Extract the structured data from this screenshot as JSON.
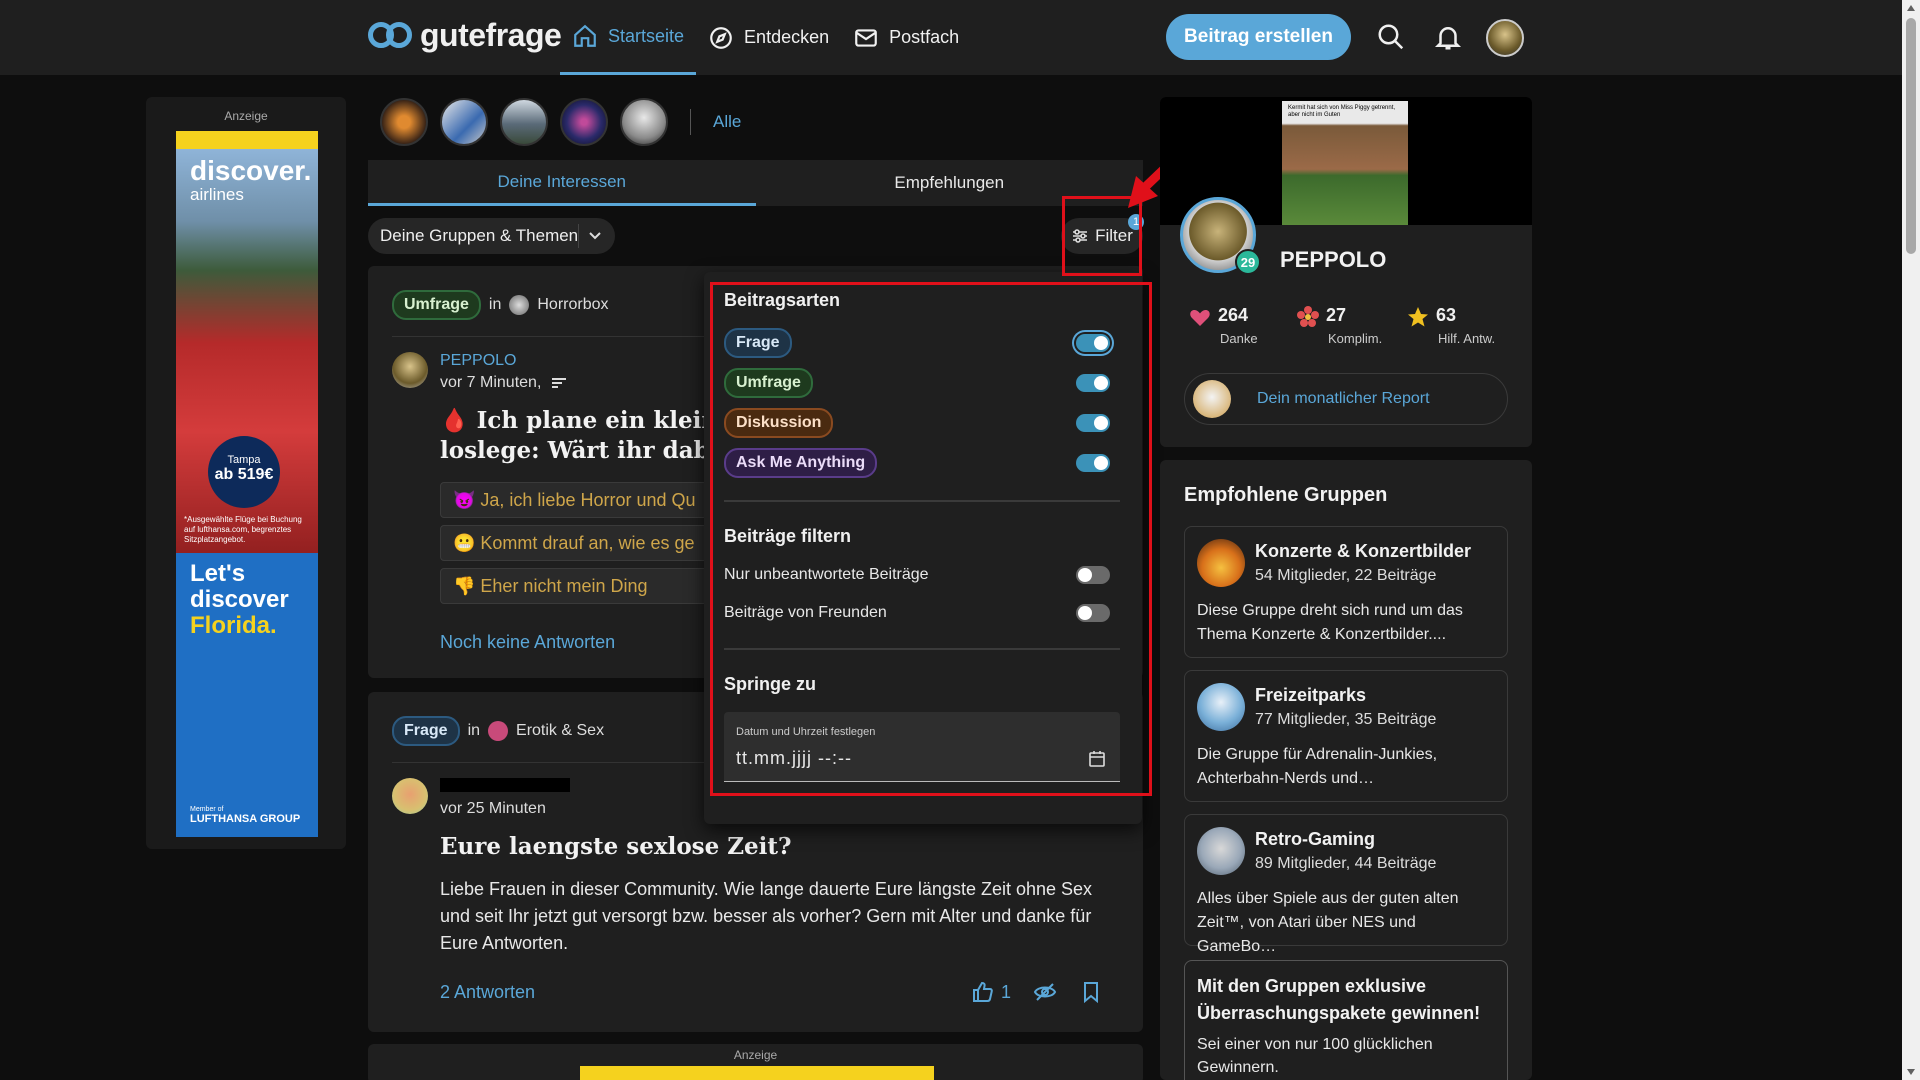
{
  "header": {
    "logo_text": "gutefrage",
    "nav": [
      {
        "label": "Startseite",
        "icon": "home-icon",
        "active": true
      },
      {
        "label": "Entdecken",
        "icon": "compass-icon",
        "active": false
      },
      {
        "label": "Postfach",
        "icon": "mail-icon",
        "active": false
      }
    ],
    "create_label": "Beitrag erstellen"
  },
  "ad_left": {
    "label": "Anzeige",
    "brand": "discover.",
    "brand_sub": "airlines",
    "price_top": "Tampa",
    "price": "ab 519€",
    "fine_print": "*Ausgewählte Flüge bei Buchung auf lufthansa.com, begrenztes Sitzplatzangebot.",
    "slogan1": "Let's",
    "slogan2": "discover",
    "slogan3": "Florida.",
    "footer_small": "Member of",
    "footer": "LUFTHANSA GROUP"
  },
  "chips": {
    "all_label": "Alle",
    "items": [
      {
        "name": "music-chip",
        "color": "#3a2416"
      },
      {
        "name": "tech-chip",
        "color": "#c9c9c9"
      },
      {
        "name": "landscape-chip",
        "color": "#8a9aa8"
      },
      {
        "name": "space-chip",
        "color": "#5a2a7a"
      },
      {
        "name": "alien-chip",
        "color": "#bdbdbd"
      }
    ]
  },
  "tabs": [
    {
      "label": "Deine Interessen",
      "active": true
    },
    {
      "label": "Empfehlungen",
      "active": false
    }
  ],
  "group_select": "Deine Gruppen & Themen",
  "filter": {
    "label": "Filter",
    "badge": "1"
  },
  "posts": [
    {
      "type": "Umfrage",
      "in": "in",
      "group": "Horrorbox",
      "author": "PEPPOLO",
      "time": "vor 7 Minuten,",
      "title_line1": "🩸 Ich plane ein kleines",
      "title_line2": "loslege: Wärt ihr dabei?",
      "options": [
        "😈 Ja, ich liebe Horror und Qu",
        "😬 Kommt drauf an, wie es ge",
        "👎 Eher nicht mein Ding"
      ],
      "answers": "Noch keine Antworten"
    },
    {
      "type": "Frage",
      "in": "in",
      "group": "Erotik & Sex",
      "time": "vor 25 Minuten",
      "title": "Eure laengste sexlose Zeit?",
      "body": "Liebe Frauen in dieser Community. Wie lange dauerte Eure längste Zeit ohne Sex und seit Ihr jetzt gut versorgt bzw. besser als vorher? Gern mit Alter und danke für Eure Antworten.",
      "answers": "2 Antworten",
      "likes": "1"
    }
  ],
  "ad_bottom_label": "Anzeige",
  "dropdown": {
    "section1": "Beitragsarten",
    "types": [
      {
        "label": "Frage",
        "on": true
      },
      {
        "label": "Umfrage",
        "on": true
      },
      {
        "label": "Diskussion",
        "on": true
      },
      {
        "label": "Ask Me Anything",
        "on": true
      }
    ],
    "section2": "Beiträge filtern",
    "filters": [
      {
        "label": "Nur unbeantwortete Beiträge",
        "on": false
      },
      {
        "label": "Beiträge von Freunden",
        "on": false
      }
    ],
    "section3": "Springe zu",
    "date_label": "Datum und Uhrzeit festlegen",
    "date_value": "tt.mm.jjjj --:--"
  },
  "profile": {
    "name": "PEPPOLO",
    "level": "29",
    "meme_text": "Kermit hat sich von Miss Piggy getrennt, aber nicht im Guten",
    "stats": [
      {
        "num": "264",
        "label": "Danke",
        "icon": "heart-icon",
        "color": "#e0507a"
      },
      {
        "num": "27",
        "label": "Komplim.",
        "icon": "flower-icon",
        "color": "#e05050"
      },
      {
        "num": "63",
        "label": "Hilf. Antw.",
        "icon": "star-icon",
        "color": "#f0c020"
      }
    ],
    "report": "Dein monatlicher Report"
  },
  "groups": {
    "title": "Empfohlene Gruppen",
    "items": [
      {
        "name": "Konzerte & Konzertbilder",
        "meta": "54 Mitglieder, 22 Beiträge",
        "desc": "Diese Gruppe dreht sich rund um das Thema Konzerte & Konzertbilder....",
        "color": "#e08a20"
      },
      {
        "name": "Freizeitparks",
        "meta": "77 Mitglieder, 35 Beiträge",
        "desc": "Die Gruppe für Adrenalin-Junkies, Achterbahn-Nerds und…",
        "color": "#7ab0d8"
      },
      {
        "name": "Retro-Gaming",
        "meta": "89 Mitglieder, 44 Beiträge",
        "desc": "Alles über Spiele aus der guten alten Zeit™, von Atari über NES und GameBo…",
        "color": "#9aa8b8"
      }
    ],
    "promo_title": "Mit den Gruppen exklusive Überraschungspakete gewinnen!",
    "promo_body": "Sei einer von nur 100 glücklichen Gewinnern."
  },
  "colors": {
    "accent": "#5aa7d8",
    "highlight": "#e0101a"
  }
}
